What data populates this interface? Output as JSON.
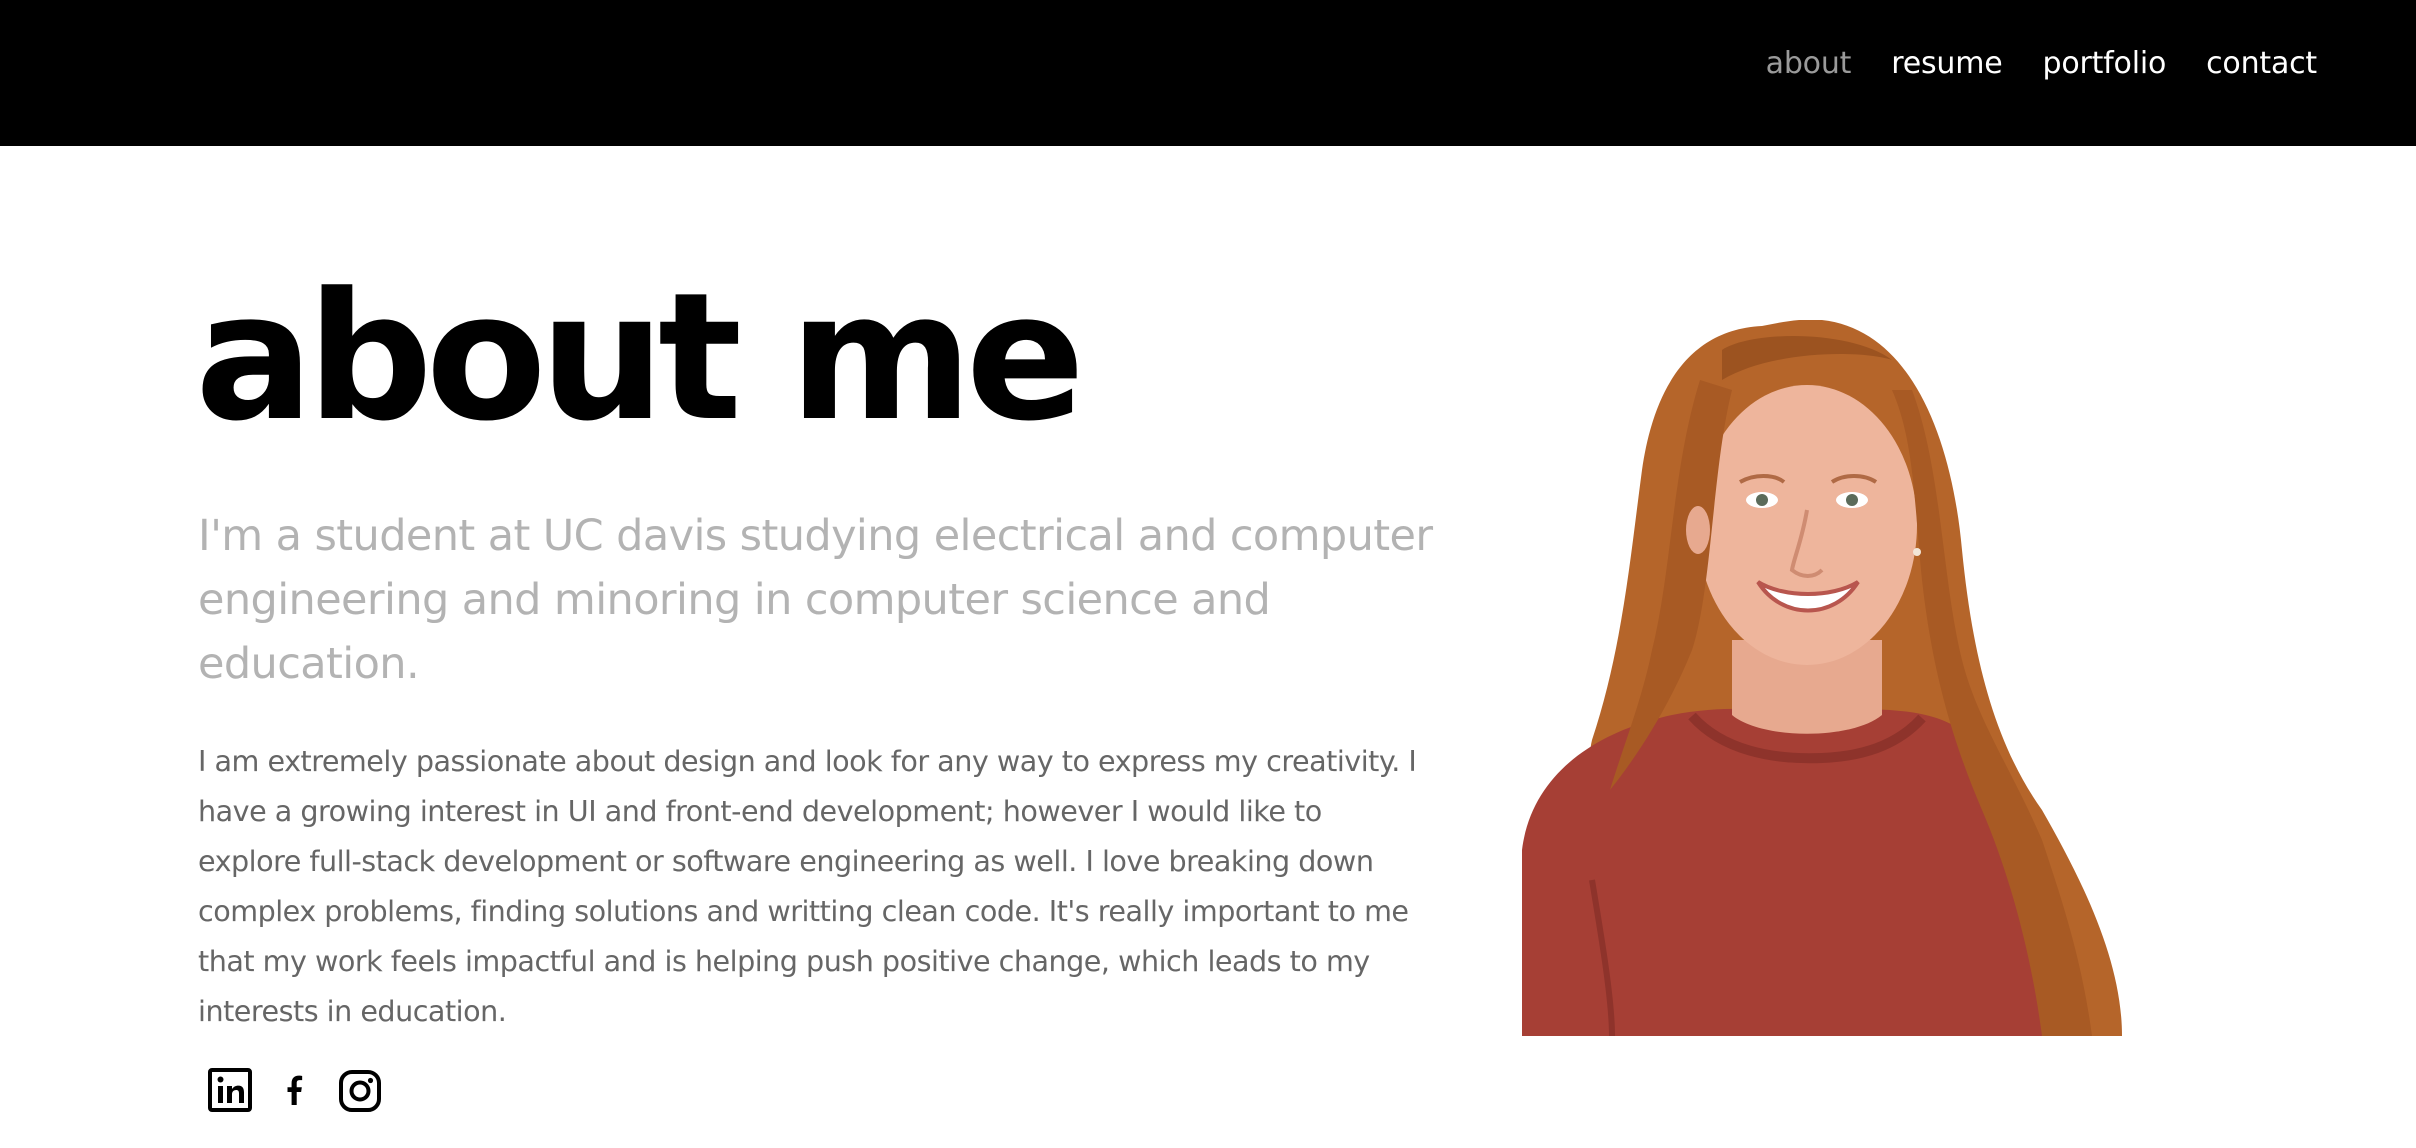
{
  "nav": {
    "items": [
      {
        "label": "about",
        "active": true
      },
      {
        "label": "resume",
        "active": false
      },
      {
        "label": "portfolio",
        "active": false
      },
      {
        "label": "contact",
        "active": false
      }
    ]
  },
  "main": {
    "heading": "about me",
    "subtitle": "I'm a student at UC davis studying electrical and computer engineering and minoring in computer science and education.",
    "bio": "I am extremely passionate about design and look for any way to express my creativity. I have a growing interest in UI and front-end development; however I would like to explore full-stack development or software engineering as well. I love breaking down complex problems, finding solutions and writting clean code. It's really important to me that my work feels impactful and is helping push positive change, which leads to my interests in education."
  },
  "socials": [
    {
      "icon": "linkedin-icon"
    },
    {
      "icon": "facebook-icon"
    },
    {
      "icon": "instagram-icon"
    }
  ],
  "colors": {
    "nav_bg": "#000000",
    "nav_text": "#ffffff",
    "nav_active": "#9a9a9a",
    "heading": "#000000",
    "subtitle": "#b3b3b3",
    "body_text": "#666666",
    "sweater": "#a63f35",
    "hair": "#b5652a"
  }
}
